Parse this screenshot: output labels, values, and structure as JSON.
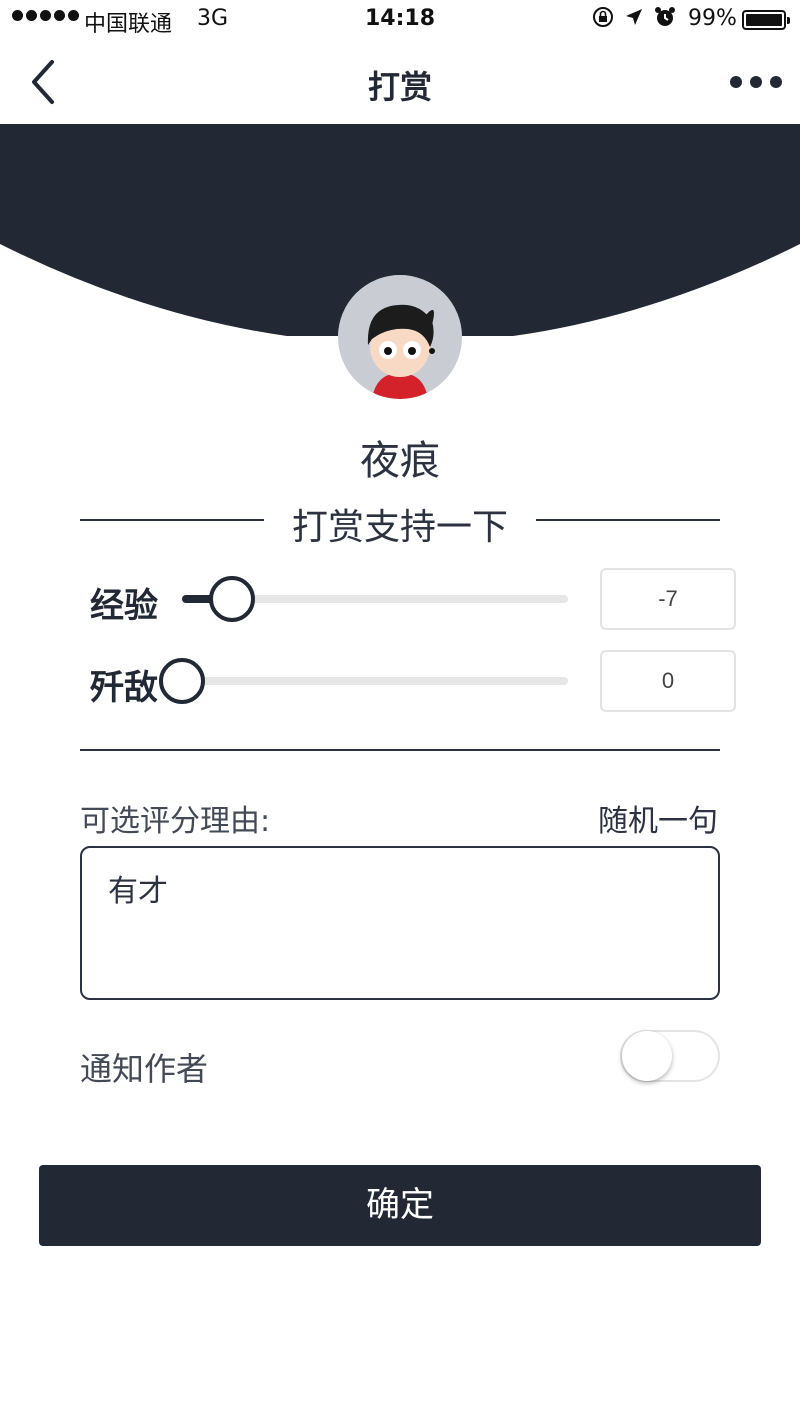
{
  "status_bar": {
    "carrier": "中国联通",
    "network": "3G",
    "time": "14:18",
    "battery_percent": "99%",
    "battery_level": 0.99,
    "icons": [
      "orientation-lock-icon",
      "location-arrow-icon",
      "alarm-icon"
    ]
  },
  "nav": {
    "title": "打赏",
    "back_icon": "chevron-left-icon",
    "more_icon": "more-dots-icon"
  },
  "colors": {
    "primary": "#222834",
    "header_bg": "#222834",
    "track": "#e6e6e6",
    "avatar_bg": "#c9cdd3"
  },
  "profile": {
    "username": "夜痕"
  },
  "section_title": "打赏支持一下",
  "sliders": [
    {
      "label": "经验",
      "value": "-7",
      "position": 0.13
    },
    {
      "label": "歼敌",
      "value": "0",
      "position": 0.0
    }
  ],
  "reason": {
    "label": "可选评分理由:",
    "random_link": "随机一句",
    "text": "有才"
  },
  "notify": {
    "label": "通知作者",
    "enabled": false
  },
  "confirm_button": "确定"
}
